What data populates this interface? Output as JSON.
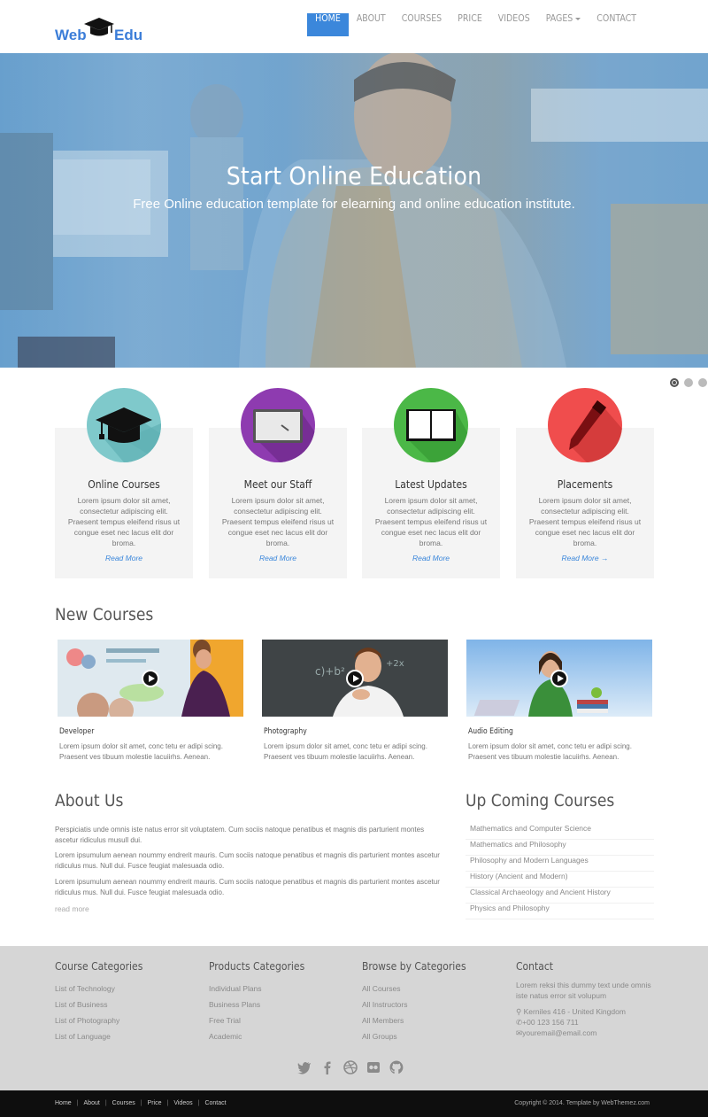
{
  "brand": {
    "part1": "Web",
    "part2": "Edu"
  },
  "nav": {
    "items": [
      "HOME",
      "ABOUT",
      "COURSES",
      "PRICE",
      "VIDEOS",
      "PAGES",
      "CONTACT"
    ],
    "active": "HOME"
  },
  "hero": {
    "title": "Start Online Education",
    "subtitle": "Free Online education template for elearning and online education institute."
  },
  "features": [
    {
      "title": "Online Courses",
      "text": "Lorem ipsum dolor sit amet, consectetur adipiscing elit. Praesent tempus eleifend risus ut congue eset nec lacus elit dor broma.",
      "more": "Read More",
      "color": "#7fc9cb",
      "icon": "graduation-cap-icon"
    },
    {
      "title": "Meet our Staff",
      "text": "Lorem ipsum dolor sit amet, consectetur adipiscing elit. Praesent tempus eleifend risus ut congue eset nec lacus elit dor broma.",
      "more": "Read More",
      "color": "#8e3bb0",
      "icon": "whiteboard-icon"
    },
    {
      "title": "Latest Updates",
      "text": "Lorem ipsum dolor sit amet, consectetur adipiscing elit. Praesent tempus eleifend risus ut congue eset nec lacus elit dor broma.",
      "more": "Read More",
      "color": "#4bb847",
      "icon": "book-icon"
    },
    {
      "title": "Placements",
      "text": "Lorem ipsum dolor sit amet, consectetur adipiscing elit. Praesent tempus eleifend risus ut congue eset nec lacus elit dor broma.",
      "more": "Read More →",
      "color": "#f04d4d",
      "icon": "pen-icon"
    }
  ],
  "new_courses": {
    "heading": "New Courses",
    "items": [
      {
        "title": "Developer",
        "text": "Lorem ipsum dolor sit amet, conc tetu er adipi scing. Praesent ves tibuum molestie lacuiirhs. Aenean."
      },
      {
        "title": "Photography",
        "text": "Lorem ipsum dolor sit amet, conc tetu er adipi scing. Praesent ves tibuum molestie lacuiirhs. Aenean."
      },
      {
        "title": "Audio Editing",
        "text": "Lorem ipsum dolor sit amet, conc tetu er adipi scing. Praesent ves tibuum molestie lacuiirhs. Aenean."
      }
    ]
  },
  "about": {
    "heading": "About Us",
    "paragraphs": [
      "Perspiciatis unde omnis iste natus error sit voluptatem. Cum sociis natoque penatibus et magnis dis parturient montes ascetur ridiculus musull dui.",
      "Lorem ipsumulum aenean noummy endrerit mauris. Cum sociis natoque penatibus et magnis dis parturient montes ascetur ridiculus mus. Null dui. Fusce feugiat malesuada odio.",
      "Lorem ipsumulum aenean noummy endrerit mauris. Cum sociis natoque penatibus et magnis dis parturient montes ascetur ridiculus mus. Null dui. Fusce feugiat malesuada odio."
    ],
    "read_more": "read more"
  },
  "upcoming": {
    "heading": "Up Coming Courses",
    "items": [
      "Mathematics and Computer Science",
      "Mathematics and Philosophy",
      "Philosophy and Modern Languages",
      "History (Ancient and Modern)",
      "Classical Archaeology and Ancient History",
      "Physics and Philosophy"
    ]
  },
  "footer": {
    "columns": [
      {
        "title": "Course Categories",
        "items": [
          "List of Technology",
          "List of Business",
          "List of Photography",
          "List of Language"
        ]
      },
      {
        "title": "Products Categories",
        "items": [
          "Individual Plans",
          "Business Plans",
          "Free Trial",
          "Academic"
        ]
      },
      {
        "title": "Browse by Categories",
        "items": [
          "All Courses",
          "All Instructors",
          "All Members",
          "All Groups"
        ]
      }
    ],
    "contact": {
      "title": "Contact",
      "text": "Lorem reksi this dummy text unde omnis iste natus error sit volupum",
      "address": "Kerniles 416 - United Kingdom",
      "phone": "+00 123 156 711",
      "email": "youremail@email.com"
    },
    "social": [
      "twitter-icon",
      "facebook-icon",
      "dribbble-icon",
      "flickr-icon",
      "github-icon"
    ]
  },
  "bottom": {
    "links": [
      "Home",
      "About",
      "Courses",
      "Price",
      "Videos",
      "Contact"
    ],
    "copyright": "Copyright © 2014. Template by  WebThemez.com"
  },
  "colors": {
    "accent": "#3b87db",
    "footer_bg": "#d6d6d6",
    "bottom_bg": "#0e0e0e"
  },
  "slider": {
    "dots": 3,
    "active_index": 0
  }
}
